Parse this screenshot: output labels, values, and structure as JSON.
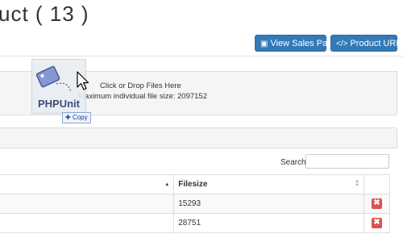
{
  "header": {
    "title": "uct ( 13 )",
    "buttons": {
      "view_sales_page": "View Sales Page",
      "product_urls": "Product URLs"
    }
  },
  "dropzone": {
    "line1": "Click or Drop Files Here",
    "line2": "Maximum individual file size: 2097152",
    "dragging_file_label": "PHPUnit",
    "drop_effect": "Copy"
  },
  "files_table": {
    "search_label": "Search:",
    "search_value": "",
    "columns": [
      "",
      "Filesize",
      ""
    ],
    "rows": [
      {
        "name": "",
        "filesize": "15293"
      },
      {
        "name": "",
        "filesize": "28751"
      }
    ]
  },
  "colors": {
    "primary": "#337ab7",
    "danger": "#d9534f",
    "panel_bg": "#f5f5f5"
  },
  "icons": {
    "sales_button": "external-link-icon",
    "urls_button": "code-icon",
    "row_action": "delete-icon",
    "sort_active": "sort-ascending-icon",
    "sort_inactive": "sort-both-icon"
  }
}
